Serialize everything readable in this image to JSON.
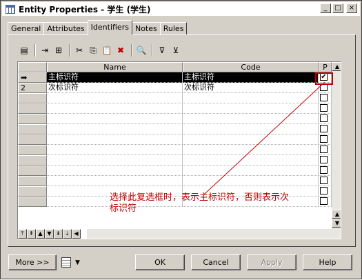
{
  "window": {
    "title": "Entity Properties - 学生 (学生)",
    "controls": [
      "_",
      "□",
      "×"
    ]
  },
  "tabs": [
    {
      "label": "General",
      "active": false
    },
    {
      "label": "Attributes",
      "active": false
    },
    {
      "label": "Identifiers",
      "active": true
    },
    {
      "label": "Notes",
      "active": false
    },
    {
      "label": "Rules",
      "active": false
    }
  ],
  "toolbar": {
    "icons": [
      "properties-icon",
      "insert-row-icon",
      "add-row-icon",
      "cut-icon",
      "copy-icon",
      "paste-icon",
      "delete-icon",
      "find-icon",
      "filter-icon",
      "clear-filter-icon"
    ],
    "glyphs": [
      "▤",
      "⇥",
      "⊞",
      "✂",
      "⎘",
      "📋",
      "✖",
      "🔍",
      "⊽",
      "⊻"
    ]
  },
  "grid": {
    "columns": {
      "name": "Name",
      "code": "Code",
      "primary": "P"
    },
    "rows": [
      {
        "marker": "➡",
        "name": "主标识符",
        "code": "主标识符",
        "primary": true,
        "selected": true
      },
      {
        "marker": "2",
        "name": "次标识符",
        "code": "次标识符",
        "primary": false,
        "selected": false
      }
    ],
    "empty_rows": 11
  },
  "nav": [
    "⤒",
    "⇞",
    "▲",
    "▼",
    "⇟",
    "⤓"
  ],
  "annotation": "选择此复选框时，表示主标识符，否则表示次标识符",
  "annotation_color": "#c00000",
  "buttons": {
    "more": "More >>",
    "ok": "OK",
    "cancel": "Cancel",
    "apply": "Apply",
    "help": "Help"
  }
}
